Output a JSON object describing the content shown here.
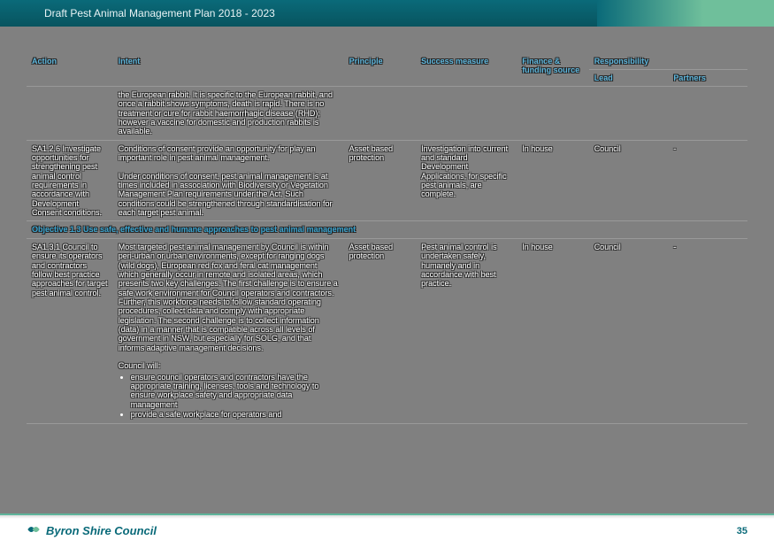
{
  "header": {
    "title": "Draft Pest Animal Management Plan 2018 - 2023"
  },
  "table": {
    "headers": {
      "action": "Action",
      "intent": "Intent",
      "principle": "Principle",
      "success": "Success measure",
      "finance": "Finance & funding source",
      "responsibility": "Responsibility",
      "lead": "Lead",
      "partners": "Partners"
    },
    "rows": [
      {
        "intent": "the European rabbit. It is specific to the European rabbit, and once a rabbit shows symptoms, death is rapid. There is no treatment or cure for rabbit haemorrhagic disease (RHD); however a vaccine for domestic and production rabbits is available."
      },
      {
        "action": "SA1.2.6 Investigate opportunities for strengthening pest animal control requirements in accordance with Development Consent conditions.",
        "intent_p1": "Conditions of consent provide an opportunity for play an important role in pest animal management.",
        "intent_p2": "Under conditions of consent, pest animal management is at times included in association with Biodiversity or Vegetation Management Plan requirements under the Act. Such conditions could be strengthened through standardisation for each target pest animal.",
        "principle": "Asset based protection",
        "success": "Investigation into current and standard Development Applications, for specific pest animals, are complete.",
        "finance": "In house",
        "lead": "Council",
        "partners": "-"
      },
      {
        "action": "SA1.3.1 Council to ensure its operators and contractors follow best practice approaches for target pest animal control.",
        "intent_p1": "Most targeted pest animal management by Council is within peri-urban or urban environments, except for ranging dogs (wild dogs), European red fox and feral cat management which generally occur in remote and isolated areas, which presents two key challenges. The first challenge is to ensure a safe work environment for Council operators and contractors. Further, this workforce needs to follow standard operating procedures, collect data and comply with appropriate legislation. The second challenge is to collect information (data) in a manner that is compatible across all levels of government in NSW, but especially for SOLG, and that informs adaptive management decisions.",
        "intent_lead": "Council will:",
        "bullets": [
          "ensure council operators and contractors have the appropriate training, licenses, tools and technology to ensure workplace safety and appropriate data management",
          "provide a safe workplace for operators and"
        ],
        "principle": "Asset based protection",
        "success": "Pest animal control is undertaken safely, humanely and in accordance with best practice.",
        "finance": "In house",
        "lead": "Council",
        "partners": "-"
      }
    ],
    "objective": "Objective 1.3 Use safe, effective and humane approaches to pest animal management"
  },
  "footer": {
    "brand": "Byron Shire Council",
    "page": "35"
  }
}
